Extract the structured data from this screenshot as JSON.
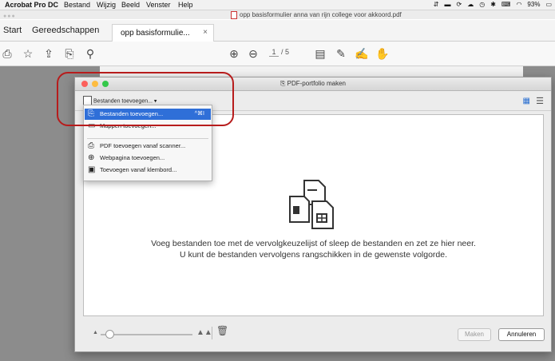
{
  "menubar": {
    "app": "Acrobat Pro DC",
    "items": [
      "Bestand",
      "Wijzig",
      "Beeld",
      "Venster",
      "Help"
    ],
    "battery": "93%"
  },
  "window": {
    "title": "opp basisformulier anna van rijn college voor akkoord.pdf"
  },
  "tabs": {
    "start": "Start",
    "tools": "Gereedschappen",
    "document": "opp basisformulie...",
    "close": "×"
  },
  "toolbar": {
    "page_current": "1",
    "page_total": "/ 5"
  },
  "dialog": {
    "title": "PDF-portfolio maken",
    "add_dropdown": "Bestanden toevoegen...",
    "menu": [
      {
        "label": "Bestanden toevoegen...",
        "shortcut": "^⌘I",
        "selected": true
      },
      {
        "label": "Mappen toevoegen..."
      },
      {
        "label": "PDF toevoegen vanaf scanner..."
      },
      {
        "label": "Webpagina toevoegen..."
      },
      {
        "label": "Toevoegen vanaf klembord..."
      }
    ],
    "instruction_line1": "Voeg bestanden toe met de vervolgkeuzelijst of sleep de bestanden en zet ze hier neer.",
    "instruction_line2": "U kunt de bestanden vervolgens rangschikken in de gewenste volgorde.",
    "make_button": "Maken",
    "cancel_button": "Annuleren"
  },
  "colors": {
    "highlight": "#2f6fd8",
    "annotation_ring": "#b71c1c",
    "close": "#fc605c",
    "minimize": "#fdbc40",
    "zoom": "#34c84a"
  }
}
